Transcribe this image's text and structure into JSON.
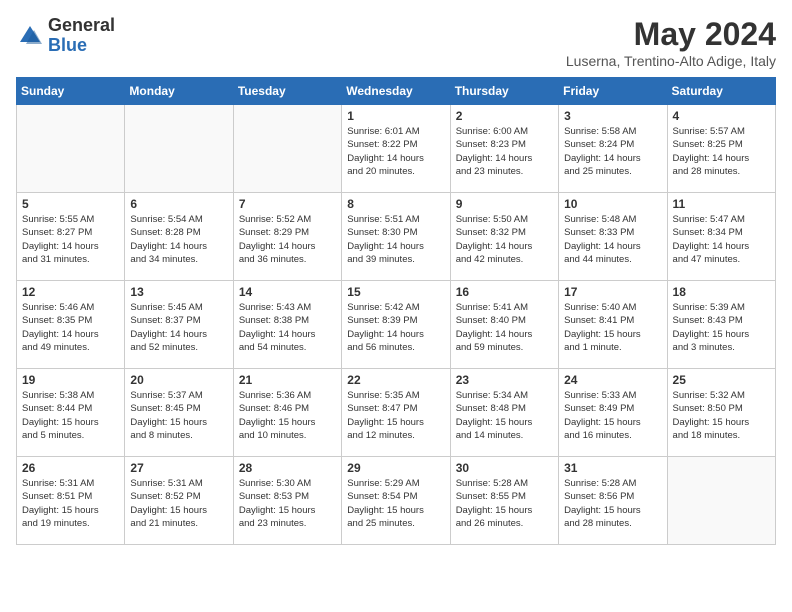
{
  "header": {
    "logo_general": "General",
    "logo_blue": "Blue",
    "month_title": "May 2024",
    "location": "Luserna, Trentino-Alto Adige, Italy"
  },
  "days_of_week": [
    "Sunday",
    "Monday",
    "Tuesday",
    "Wednesday",
    "Thursday",
    "Friday",
    "Saturday"
  ],
  "weeks": [
    [
      {
        "day": "",
        "info": ""
      },
      {
        "day": "",
        "info": ""
      },
      {
        "day": "",
        "info": ""
      },
      {
        "day": "1",
        "info": "Sunrise: 6:01 AM\nSunset: 8:22 PM\nDaylight: 14 hours\nand 20 minutes."
      },
      {
        "day": "2",
        "info": "Sunrise: 6:00 AM\nSunset: 8:23 PM\nDaylight: 14 hours\nand 23 minutes."
      },
      {
        "day": "3",
        "info": "Sunrise: 5:58 AM\nSunset: 8:24 PM\nDaylight: 14 hours\nand 25 minutes."
      },
      {
        "day": "4",
        "info": "Sunrise: 5:57 AM\nSunset: 8:25 PM\nDaylight: 14 hours\nand 28 minutes."
      }
    ],
    [
      {
        "day": "5",
        "info": "Sunrise: 5:55 AM\nSunset: 8:27 PM\nDaylight: 14 hours\nand 31 minutes."
      },
      {
        "day": "6",
        "info": "Sunrise: 5:54 AM\nSunset: 8:28 PM\nDaylight: 14 hours\nand 34 minutes."
      },
      {
        "day": "7",
        "info": "Sunrise: 5:52 AM\nSunset: 8:29 PM\nDaylight: 14 hours\nand 36 minutes."
      },
      {
        "day": "8",
        "info": "Sunrise: 5:51 AM\nSunset: 8:30 PM\nDaylight: 14 hours\nand 39 minutes."
      },
      {
        "day": "9",
        "info": "Sunrise: 5:50 AM\nSunset: 8:32 PM\nDaylight: 14 hours\nand 42 minutes."
      },
      {
        "day": "10",
        "info": "Sunrise: 5:48 AM\nSunset: 8:33 PM\nDaylight: 14 hours\nand 44 minutes."
      },
      {
        "day": "11",
        "info": "Sunrise: 5:47 AM\nSunset: 8:34 PM\nDaylight: 14 hours\nand 47 minutes."
      }
    ],
    [
      {
        "day": "12",
        "info": "Sunrise: 5:46 AM\nSunset: 8:35 PM\nDaylight: 14 hours\nand 49 minutes."
      },
      {
        "day": "13",
        "info": "Sunrise: 5:45 AM\nSunset: 8:37 PM\nDaylight: 14 hours\nand 52 minutes."
      },
      {
        "day": "14",
        "info": "Sunrise: 5:43 AM\nSunset: 8:38 PM\nDaylight: 14 hours\nand 54 minutes."
      },
      {
        "day": "15",
        "info": "Sunrise: 5:42 AM\nSunset: 8:39 PM\nDaylight: 14 hours\nand 56 minutes."
      },
      {
        "day": "16",
        "info": "Sunrise: 5:41 AM\nSunset: 8:40 PM\nDaylight: 14 hours\nand 59 minutes."
      },
      {
        "day": "17",
        "info": "Sunrise: 5:40 AM\nSunset: 8:41 PM\nDaylight: 15 hours\nand 1 minute."
      },
      {
        "day": "18",
        "info": "Sunrise: 5:39 AM\nSunset: 8:43 PM\nDaylight: 15 hours\nand 3 minutes."
      }
    ],
    [
      {
        "day": "19",
        "info": "Sunrise: 5:38 AM\nSunset: 8:44 PM\nDaylight: 15 hours\nand 5 minutes."
      },
      {
        "day": "20",
        "info": "Sunrise: 5:37 AM\nSunset: 8:45 PM\nDaylight: 15 hours\nand 8 minutes."
      },
      {
        "day": "21",
        "info": "Sunrise: 5:36 AM\nSunset: 8:46 PM\nDaylight: 15 hours\nand 10 minutes."
      },
      {
        "day": "22",
        "info": "Sunrise: 5:35 AM\nSunset: 8:47 PM\nDaylight: 15 hours\nand 12 minutes."
      },
      {
        "day": "23",
        "info": "Sunrise: 5:34 AM\nSunset: 8:48 PM\nDaylight: 15 hours\nand 14 minutes."
      },
      {
        "day": "24",
        "info": "Sunrise: 5:33 AM\nSunset: 8:49 PM\nDaylight: 15 hours\nand 16 minutes."
      },
      {
        "day": "25",
        "info": "Sunrise: 5:32 AM\nSunset: 8:50 PM\nDaylight: 15 hours\nand 18 minutes."
      }
    ],
    [
      {
        "day": "26",
        "info": "Sunrise: 5:31 AM\nSunset: 8:51 PM\nDaylight: 15 hours\nand 19 minutes."
      },
      {
        "day": "27",
        "info": "Sunrise: 5:31 AM\nSunset: 8:52 PM\nDaylight: 15 hours\nand 21 minutes."
      },
      {
        "day": "28",
        "info": "Sunrise: 5:30 AM\nSunset: 8:53 PM\nDaylight: 15 hours\nand 23 minutes."
      },
      {
        "day": "29",
        "info": "Sunrise: 5:29 AM\nSunset: 8:54 PM\nDaylight: 15 hours\nand 25 minutes."
      },
      {
        "day": "30",
        "info": "Sunrise: 5:28 AM\nSunset: 8:55 PM\nDaylight: 15 hours\nand 26 minutes."
      },
      {
        "day": "31",
        "info": "Sunrise: 5:28 AM\nSunset: 8:56 PM\nDaylight: 15 hours\nand 28 minutes."
      },
      {
        "day": "",
        "info": ""
      }
    ]
  ]
}
